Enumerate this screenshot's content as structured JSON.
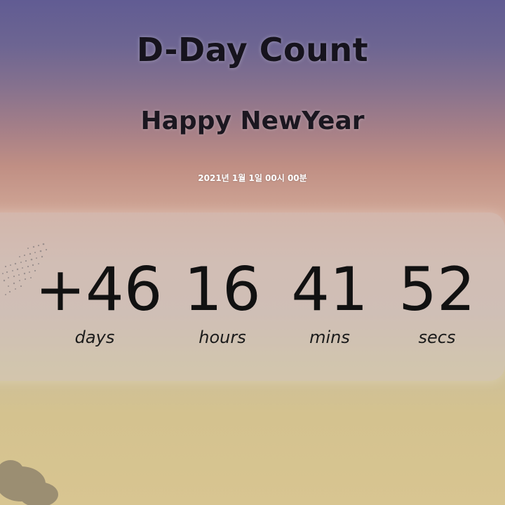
{
  "header": {
    "title": "D-Day Count",
    "subtitle": "Happy NewYear",
    "target_date": "2021년 1월 1일 00시 00분"
  },
  "countdown": {
    "days": {
      "value": "+46",
      "label": "days"
    },
    "hours": {
      "value": "16",
      "label": "hours"
    },
    "mins": {
      "value": "41",
      "label": "mins"
    },
    "secs": {
      "value": "52",
      "label": "secs"
    }
  },
  "colors": {
    "sky_top": "#615c93",
    "sky_middle": "#c08f84",
    "sky_bottom": "#d8c591",
    "text_dark": "#16131d"
  }
}
